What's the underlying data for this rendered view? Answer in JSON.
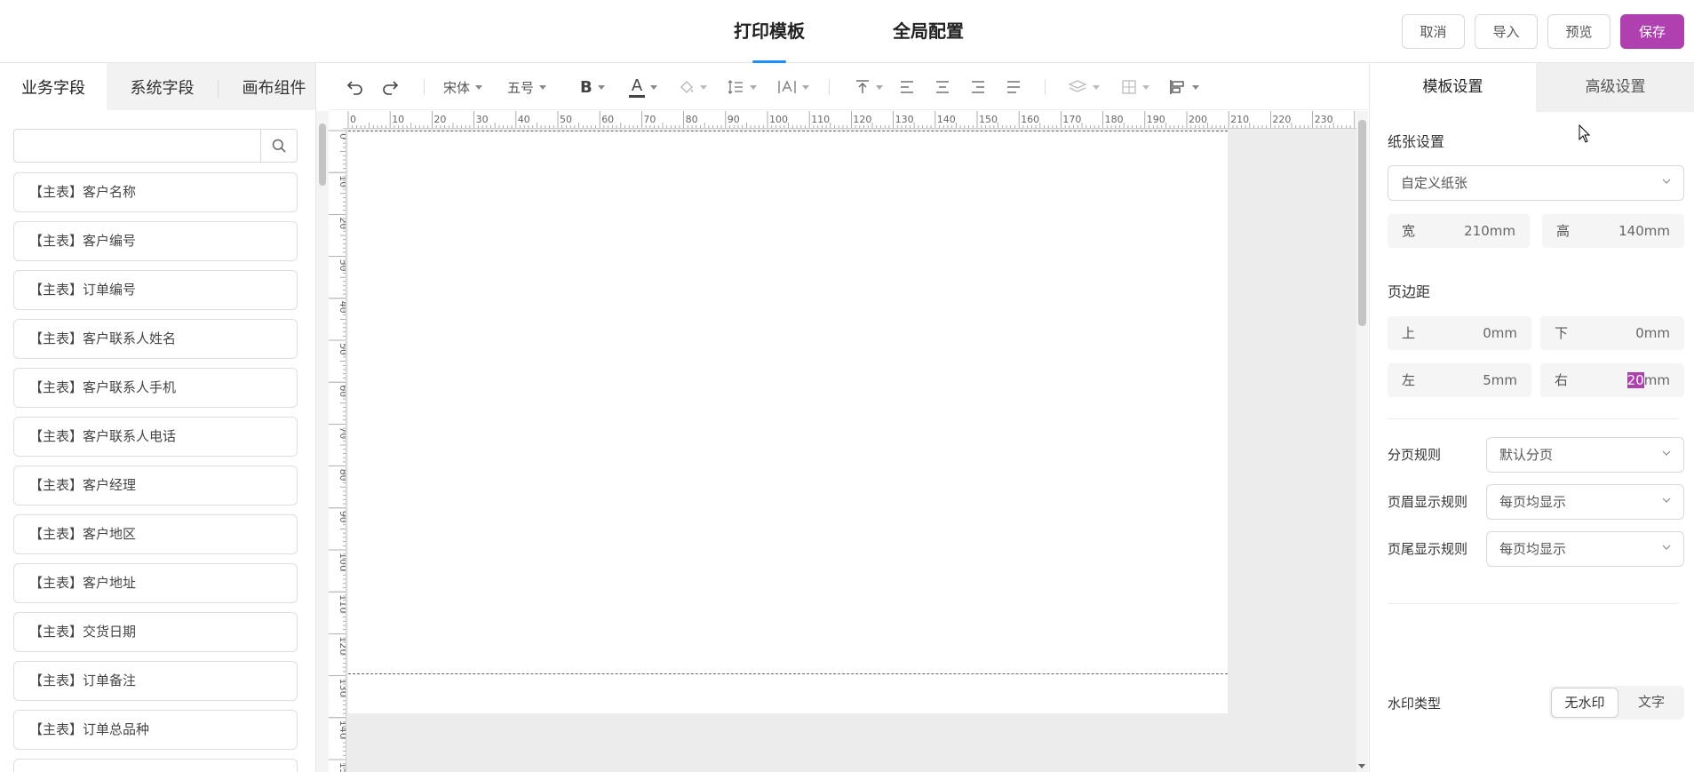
{
  "header": {
    "tabs": [
      {
        "label": "打印模板",
        "active": true
      },
      {
        "label": "全局配置",
        "active": false
      }
    ],
    "buttons": {
      "cancel": "取消",
      "import": "导入",
      "preview": "预览",
      "save": "保存"
    },
    "accent_color": "#b040b0",
    "tab_underline_color": "#1890ff"
  },
  "left_panel": {
    "tabs": [
      {
        "label": "业务字段",
        "active": true
      },
      {
        "label": "系统字段",
        "active": false
      },
      {
        "label": "画布组件",
        "active": false
      }
    ],
    "search": {
      "value": "",
      "placeholder": "",
      "icon": "search-icon"
    },
    "fields": [
      "【主表】客户名称",
      "【主表】客户编号",
      "【主表】订单编号",
      "【主表】客户联系人姓名",
      "【主表】客户联系人手机",
      "【主表】客户联系人电话",
      "【主表】客户经理",
      "【主表】客户地区",
      "【主表】客户地址",
      "【主表】交货日期",
      "【主表】订单备注",
      "【主表】订单总品种"
    ]
  },
  "toolbar": {
    "undo": "undo-icon",
    "redo": "redo-icon",
    "font_family": "宋体",
    "font_size": "五号",
    "bold": "B",
    "font_color_glyph": "A",
    "icons": [
      "undo-icon",
      "redo-icon",
      "bold-icon",
      "font-color-icon",
      "fill-color-icon",
      "line-height-icon",
      "letter-spacing-icon",
      "vertical-align-top-icon",
      "align-left-icon",
      "align-center-icon",
      "align-right-icon",
      "align-justify-icon",
      "layer-icon",
      "border-icon",
      "position-align-icon"
    ]
  },
  "ruler": {
    "horizontal_ticks": [
      "0",
      "10",
      "20",
      "30",
      "40",
      "50",
      "60",
      "70",
      "80",
      "90",
      "100",
      "110",
      "120",
      "130",
      "140",
      "150",
      "160",
      "170",
      "180",
      "190",
      "200",
      "210",
      "220",
      "230"
    ],
    "vertical_ticks": [
      "0",
      "10",
      "20",
      "30",
      "40",
      "50",
      "60",
      "70",
      "80",
      "90",
      "100",
      "110",
      "120",
      "130",
      "140",
      "150"
    ]
  },
  "right_panel": {
    "tabs": [
      {
        "label": "模板设置",
        "active": true
      },
      {
        "label": "高级设置",
        "active": false
      }
    ],
    "paper": {
      "section_label": "纸张设置",
      "type": "自定义纸张",
      "width_label": "宽",
      "width_value": "210mm",
      "height_label": "高",
      "height_value": "140mm"
    },
    "margin": {
      "section_label": "页边距",
      "top_label": "上",
      "top_value": "0mm",
      "bottom_label": "下",
      "bottom_value": "0mm",
      "left_label": "左",
      "left_value": "5mm",
      "right_label": "右",
      "right_value_selected": "20",
      "right_value_unit": "mm"
    },
    "rules": [
      {
        "label": "分页规则",
        "value": "默认分页"
      },
      {
        "label": "页眉显示规则",
        "value": "每页均显示"
      },
      {
        "label": "页尾显示规则",
        "value": "每页均显示"
      }
    ],
    "watermark": {
      "label": "水印类型",
      "options": [
        {
          "label": "无水印",
          "selected": true
        },
        {
          "label": "文字",
          "selected": false
        }
      ]
    }
  }
}
